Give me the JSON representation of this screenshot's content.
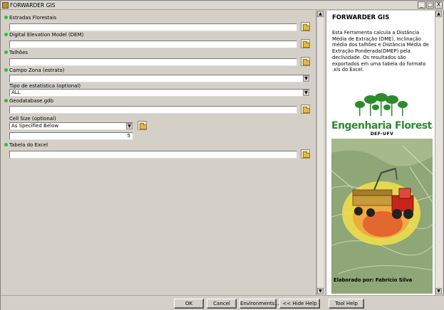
{
  "window": {
    "title": "FORWARDER GIS",
    "controls": [
      "_",
      "□",
      "X"
    ]
  },
  "form": {
    "estradas": {
      "label": "Estradas Florestais",
      "value": ""
    },
    "dem": {
      "label": "Digital Elevation Model (DEM)",
      "value": ""
    },
    "talhoes": {
      "label": "Talhões",
      "value": ""
    },
    "campo_zona": {
      "label": "Campo Zona (estrato)",
      "value": ""
    },
    "tipo_estatistica": {
      "label": "Tipo de estatística (optional)",
      "value": "ALL"
    },
    "geodatabase": {
      "label": "Geodatabase.gdb",
      "value": ""
    },
    "cell_size": {
      "label": "Cell Size (optional)",
      "value": "As Specified Below",
      "number": "5"
    },
    "tabela_excel": {
      "label": "Tabela do Excel",
      "value": ""
    }
  },
  "help": {
    "title": "FORWARDER GIS",
    "body": "Esta Ferramenta calcula a Distância Média de Extração (DME), Inclinação média dos talhões e Distância Média de Extração Ponderada(DMEP) pela declividade. Os resultados são exportados em uma tabela do formato .xls do Excel.",
    "logo_title": "Engenharia Florestal",
    "logo_sub": "DEF-UFV",
    "credit": "Elaborado por: Fabrício Silva"
  },
  "buttons": {
    "ok": "OK",
    "cancel": "Cancel",
    "environments": "Environments...",
    "hide_help": "<< Hide Help",
    "tool_help": "Tool Help"
  },
  "colors": {
    "required_dot": "#2cc02c",
    "logo_green": "#2d8a2d",
    "panel_bg": "#d4d0c8"
  }
}
